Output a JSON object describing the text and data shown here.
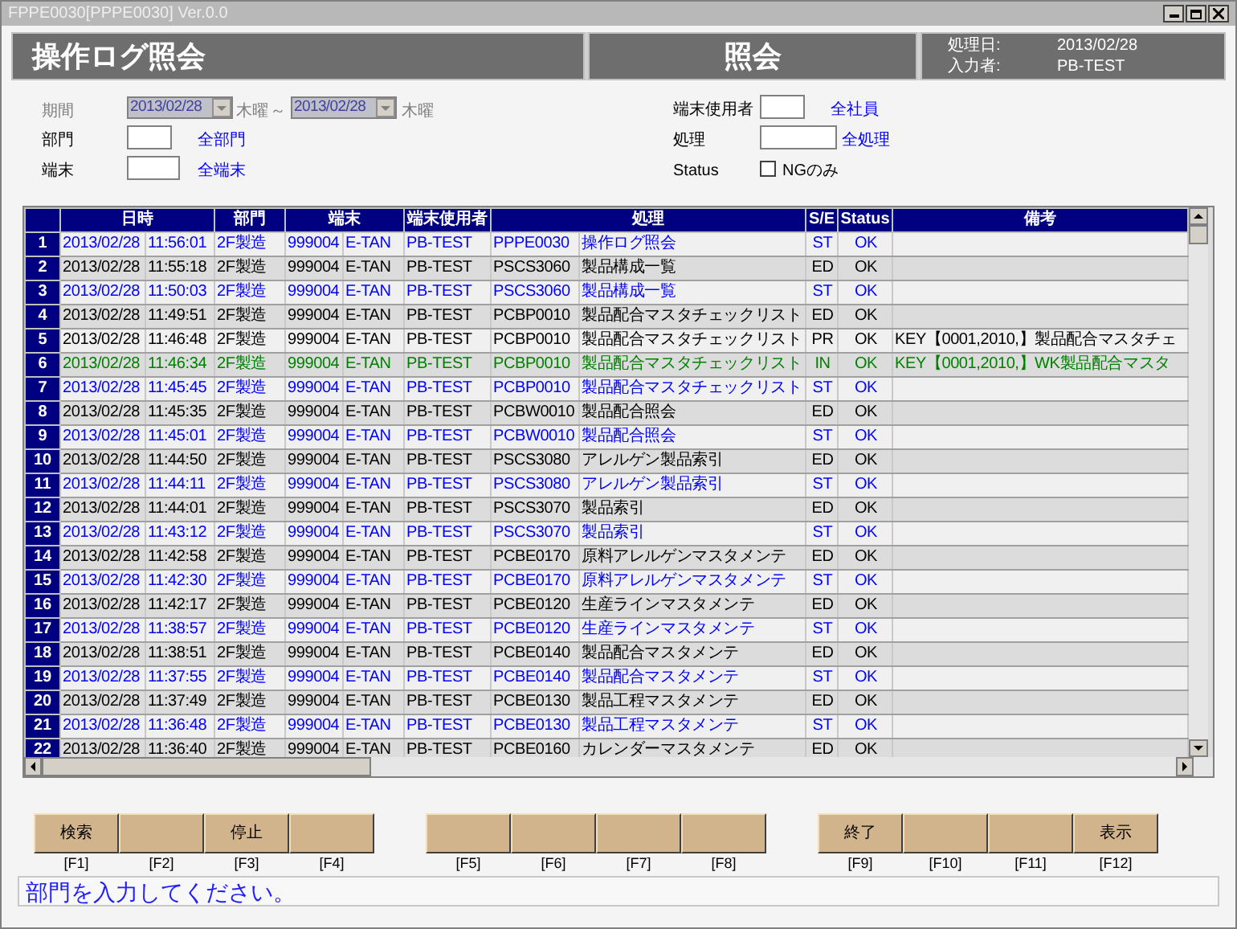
{
  "window": {
    "title": "FPPE0030[PPPE0030] Ver.0.0"
  },
  "header": {
    "title": "操作ログ照会",
    "mode": "照会",
    "info": [
      {
        "label": "処理日:",
        "value": "2013/02/28"
      },
      {
        "label": "入力者:",
        "value": "PB-TEST"
      }
    ]
  },
  "filters": {
    "period": {
      "label": "期間",
      "disabled": true,
      "from": "2013/02/28",
      "from_weekday": "木曜",
      "separator": "～",
      "to": "2013/02/28",
      "to_weekday": "木曜"
    },
    "department": {
      "label": "部門",
      "link": "全部門"
    },
    "terminal": {
      "label": "端末",
      "link": "全端末"
    },
    "terminal_user": {
      "label": "端末使用者",
      "link": "全社員"
    },
    "process": {
      "label": "処理",
      "link": "全処理"
    },
    "status": {
      "label": "Status",
      "option": "NGのみ",
      "checked": false
    }
  },
  "table": {
    "columns": [
      "日時",
      "部門",
      "端末",
      "端末使用者",
      "処理",
      "S/E",
      "Status",
      "備考"
    ],
    "rows": [
      {
        "no": "1",
        "date": "2013/02/28",
        "time": "11:56:01",
        "dept": "2F製造",
        "term_code": "999004",
        "term_name": "E-TAN",
        "user": "PB-TEST",
        "proc_code": "PPPE0030",
        "proc_name": "操作ログ照会",
        "se": "ST",
        "status": "OK",
        "color": "#0000ff"
      },
      {
        "no": "2",
        "date": "2013/02/28",
        "time": "11:55:18",
        "dept": "2F製造",
        "term_code": "999004",
        "term_name": "E-TAN",
        "user": "PB-TEST",
        "proc_code": "PSCS3060",
        "proc_name": "製品構成一覧",
        "se": "ED",
        "status": "OK",
        "color": "#000000"
      },
      {
        "no": "3",
        "date": "2013/02/28",
        "time": "11:50:03",
        "dept": "2F製造",
        "term_code": "999004",
        "term_name": "E-TAN",
        "user": "PB-TEST",
        "proc_code": "PSCS3060",
        "proc_name": "製品構成一覧",
        "se": "ST",
        "status": "OK",
        "color": "#0000ff"
      },
      {
        "no": "4",
        "date": "2013/02/28",
        "time": "11:49:51",
        "dept": "2F製造",
        "term_code": "999004",
        "term_name": "E-TAN",
        "user": "PB-TEST",
        "proc_code": "PCBP0010",
        "proc_name": "製品配合マスタチェックリスト",
        "se": "ED",
        "status": "OK",
        "color": "#000000"
      },
      {
        "no": "5",
        "date": "2013/02/28",
        "time": "11:46:48",
        "dept": "2F製造",
        "term_code": "999004",
        "term_name": "E-TAN",
        "user": "PB-TEST",
        "proc_code": "PCBP0010",
        "proc_name": "製品配合マスタチェックリスト",
        "se": "PR",
        "status": "OK",
        "note": "KEY【0001,2010,】製品配合マスタチェ",
        "color": "#000000"
      },
      {
        "no": "6",
        "date": "2013/02/28",
        "time": "11:46:34",
        "dept": "2F製造",
        "term_code": "999004",
        "term_name": "E-TAN",
        "user": "PB-TEST",
        "proc_code": "PCBP0010",
        "proc_name": "製品配合マスタチェックリスト",
        "se": "IN",
        "status": "OK",
        "note": "KEY【0001,2010,】WK製品配合マスタ",
        "color": "#008000"
      },
      {
        "no": "7",
        "date": "2013/02/28",
        "time": "11:45:45",
        "dept": "2F製造",
        "term_code": "999004",
        "term_name": "E-TAN",
        "user": "PB-TEST",
        "proc_code": "PCBP0010",
        "proc_name": "製品配合マスタチェックリスト",
        "se": "ST",
        "status": "OK",
        "color": "#0000ff"
      },
      {
        "no": "8",
        "date": "2013/02/28",
        "time": "11:45:35",
        "dept": "2F製造",
        "term_code": "999004",
        "term_name": "E-TAN",
        "user": "PB-TEST",
        "proc_code": "PCBW0010",
        "proc_name": "製品配合照会",
        "se": "ED",
        "status": "OK",
        "color": "#000000"
      },
      {
        "no": "9",
        "date": "2013/02/28",
        "time": "11:45:01",
        "dept": "2F製造",
        "term_code": "999004",
        "term_name": "E-TAN",
        "user": "PB-TEST",
        "proc_code": "PCBW0010",
        "proc_name": "製品配合照会",
        "se": "ST",
        "status": "OK",
        "color": "#0000ff"
      },
      {
        "no": "10",
        "date": "2013/02/28",
        "time": "11:44:50",
        "dept": "2F製造",
        "term_code": "999004",
        "term_name": "E-TAN",
        "user": "PB-TEST",
        "proc_code": "PSCS3080",
        "proc_name": "アレルゲン製品索引",
        "se": "ED",
        "status": "OK",
        "color": "#000000"
      },
      {
        "no": "11",
        "date": "2013/02/28",
        "time": "11:44:11",
        "dept": "2F製造",
        "term_code": "999004",
        "term_name": "E-TAN",
        "user": "PB-TEST",
        "proc_code": "PSCS3080",
        "proc_name": "アレルゲン製品索引",
        "se": "ST",
        "status": "OK",
        "color": "#0000ff"
      },
      {
        "no": "12",
        "date": "2013/02/28",
        "time": "11:44:01",
        "dept": "2F製造",
        "term_code": "999004",
        "term_name": "E-TAN",
        "user": "PB-TEST",
        "proc_code": "PSCS3070",
        "proc_name": "製品索引",
        "se": "ED",
        "status": "OK",
        "color": "#000000"
      },
      {
        "no": "13",
        "date": "2013/02/28",
        "time": "11:43:12",
        "dept": "2F製造",
        "term_code": "999004",
        "term_name": "E-TAN",
        "user": "PB-TEST",
        "proc_code": "PSCS3070",
        "proc_name": "製品索引",
        "se": "ST",
        "status": "OK",
        "color": "#0000ff"
      },
      {
        "no": "14",
        "date": "2013/02/28",
        "time": "11:42:58",
        "dept": "2F製造",
        "term_code": "999004",
        "term_name": "E-TAN",
        "user": "PB-TEST",
        "proc_code": "PCBE0170",
        "proc_name": "原料アレルゲンマスタメンテ",
        "se": "ED",
        "status": "OK",
        "color": "#000000"
      },
      {
        "no": "15",
        "date": "2013/02/28",
        "time": "11:42:30",
        "dept": "2F製造",
        "term_code": "999004",
        "term_name": "E-TAN",
        "user": "PB-TEST",
        "proc_code": "PCBE0170",
        "proc_name": "原料アレルゲンマスタメンテ",
        "se": "ST",
        "status": "OK",
        "color": "#0000ff"
      },
      {
        "no": "16",
        "date": "2013/02/28",
        "time": "11:42:17",
        "dept": "2F製造",
        "term_code": "999004",
        "term_name": "E-TAN",
        "user": "PB-TEST",
        "proc_code": "PCBE0120",
        "proc_name": "生産ラインマスタメンテ",
        "se": "ED",
        "status": "OK",
        "color": "#000000"
      },
      {
        "no": "17",
        "date": "2013/02/28",
        "time": "11:38:57",
        "dept": "2F製造",
        "term_code": "999004",
        "term_name": "E-TAN",
        "user": "PB-TEST",
        "proc_code": "PCBE0120",
        "proc_name": "生産ラインマスタメンテ",
        "se": "ST",
        "status": "OK",
        "color": "#0000ff"
      },
      {
        "no": "18",
        "date": "2013/02/28",
        "time": "11:38:51",
        "dept": "2F製造",
        "term_code": "999004",
        "term_name": "E-TAN",
        "user": "PB-TEST",
        "proc_code": "PCBE0140",
        "proc_name": "製品配合マスタメンテ",
        "se": "ED",
        "status": "OK",
        "color": "#000000"
      },
      {
        "no": "19",
        "date": "2013/02/28",
        "time": "11:37:55",
        "dept": "2F製造",
        "term_code": "999004",
        "term_name": "E-TAN",
        "user": "PB-TEST",
        "proc_code": "PCBE0140",
        "proc_name": "製品配合マスタメンテ",
        "se": "ST",
        "status": "OK",
        "color": "#0000ff"
      },
      {
        "no": "20",
        "date": "2013/02/28",
        "time": "11:37:49",
        "dept": "2F製造",
        "term_code": "999004",
        "term_name": "E-TAN",
        "user": "PB-TEST",
        "proc_code": "PCBE0130",
        "proc_name": "製品工程マスタメンテ",
        "se": "ED",
        "status": "OK",
        "color": "#000000"
      },
      {
        "no": "21",
        "date": "2013/02/28",
        "time": "11:36:48",
        "dept": "2F製造",
        "term_code": "999004",
        "term_name": "E-TAN",
        "user": "PB-TEST",
        "proc_code": "PCBE0130",
        "proc_name": "製品工程マスタメンテ",
        "se": "ST",
        "status": "OK",
        "color": "#0000ff"
      },
      {
        "no": "22",
        "date": "2013/02/28",
        "time": "11:36:40",
        "dept": "2F製造",
        "term_code": "999004",
        "term_name": "E-TAN",
        "user": "PB-TEST",
        "proc_code": "PCBE0160",
        "proc_name": "カレンダーマスタメンテ",
        "se": "ED",
        "status": "OK",
        "color": "#000000"
      }
    ]
  },
  "function_keys": [
    [
      {
        "label": "検索",
        "key": "[F1]"
      },
      {
        "key": "[F2]"
      },
      {
        "label": "停止",
        "key": "[F3]"
      },
      {
        "key": "[F4]"
      }
    ],
    [
      {
        "key": "[F5]"
      },
      {
        "key": "[F6]"
      },
      {
        "key": "[F7]"
      },
      {
        "key": "[F8]"
      }
    ],
    [
      {
        "label": "終了",
        "key": "[F9]"
      },
      {
        "key": "[F10]"
      },
      {
        "key": "[F11]"
      },
      {
        "label": "表示",
        "key": "[F12]"
      }
    ]
  ],
  "message": "部門を入力してください。"
}
